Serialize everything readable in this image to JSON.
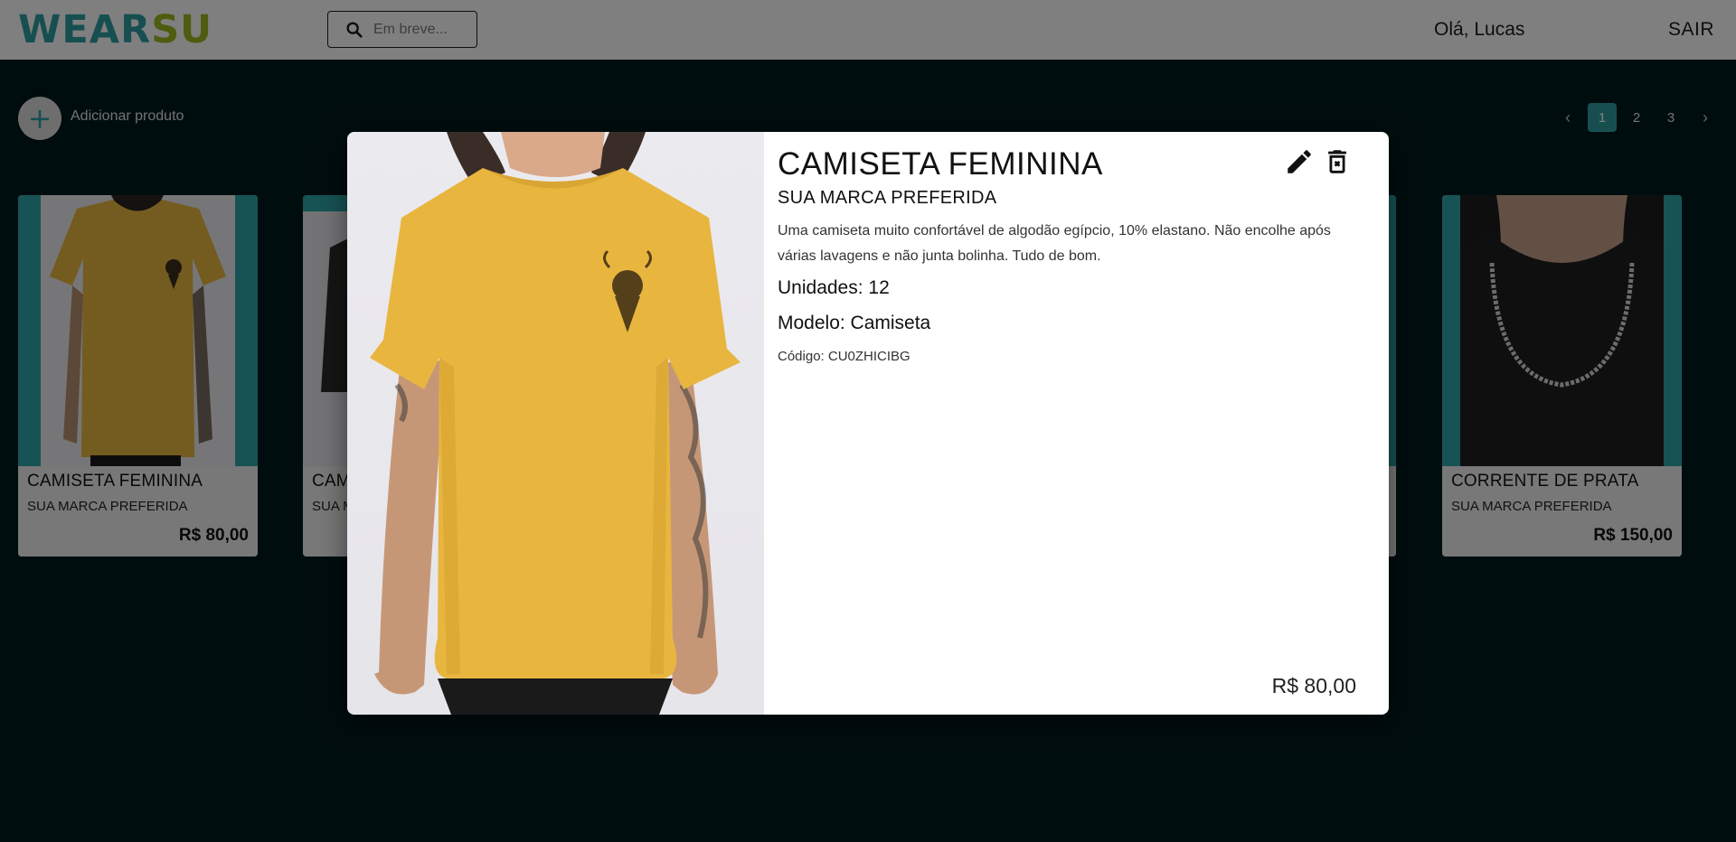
{
  "header": {
    "logo_part1": "WEAR",
    "logo_part2": "SU",
    "search_placeholder": "Em breve...",
    "greeting": "Olá, Lucas",
    "logout_label": "SAIR"
  },
  "toolbar": {
    "add_icon": "+",
    "add_label": "Adicionar produto"
  },
  "pagination": {
    "prev_label": "‹",
    "pages": [
      "1",
      "2",
      "3"
    ],
    "active_page": "1",
    "next_label": "›"
  },
  "products": [
    {
      "name": "CAMISETA FEMININA",
      "brand": "SUA MARCA PREFERIDA",
      "price": "R$ 80,00"
    },
    {
      "name": "CAMISETA FEMININA",
      "brand": "SUA MARCA PREFERIDA",
      "price": ""
    },
    {
      "name": "CORRENTE DE PRATA",
      "brand": "SUA MARCA PREFERIDA",
      "price": "R$ 150,00"
    }
  ],
  "modal": {
    "title": "CAMISETA FEMININA",
    "brand": "SUA MARCA PREFERIDA",
    "description": "Uma camiseta muito confortável de algodão egípcio, 10% elastano. Não encolhe após várias lavagens e não junta bolinha. Tudo de bom.",
    "units": "Unidades: 12",
    "model": "Modelo: Camiseta",
    "code": "Código: CU0ZHICIBG",
    "price": "R$ 80,00",
    "edit_icon": "pencil-icon",
    "delete_icon": "trash-x-icon"
  },
  "colors": {
    "accent_teal": "#2e9fa3",
    "logo_green": "#9bb81f",
    "page_bg": "#001a1f",
    "shirt_yellow": "#e8b63f"
  }
}
